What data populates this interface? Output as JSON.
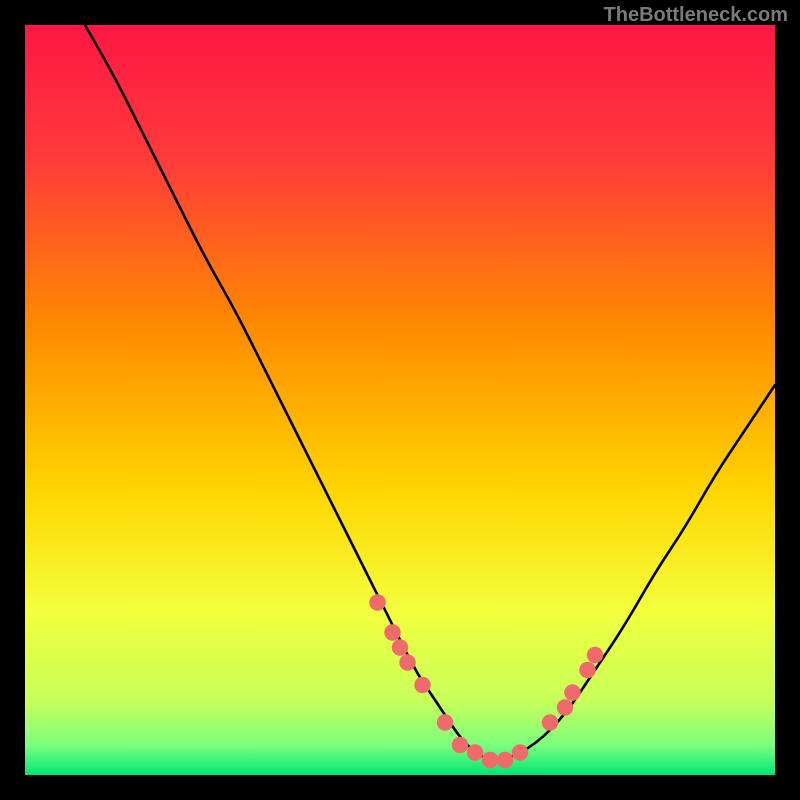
{
  "watermark": "TheBottleneck.com",
  "chart_data": {
    "type": "line",
    "title": "",
    "xlabel": "",
    "ylabel": "",
    "xlim": [
      0,
      100
    ],
    "ylim": [
      0,
      100
    ],
    "grid": false,
    "legend": false,
    "background_gradient_stops": [
      {
        "offset": 0.0,
        "color": "#ff1744"
      },
      {
        "offset": 0.18,
        "color": "#ff3b3b"
      },
      {
        "offset": 0.4,
        "color": "#ff8a00"
      },
      {
        "offset": 0.62,
        "color": "#ffd500"
      },
      {
        "offset": 0.78,
        "color": "#f4ff3d"
      },
      {
        "offset": 0.9,
        "color": "#c8ff5a"
      },
      {
        "offset": 0.96,
        "color": "#7dff7d"
      },
      {
        "offset": 1.0,
        "color": "#00e676"
      }
    ],
    "series": [
      {
        "name": "bottleneck-curve",
        "color": "#000000",
        "x": [
          8,
          12,
          16,
          20,
          24,
          28,
          32,
          36,
          40,
          44,
          48,
          52,
          54,
          56,
          58,
          60,
          62,
          64,
          68,
          72,
          76,
          80,
          84,
          88,
          92,
          96,
          100
        ],
        "y": [
          100,
          93,
          85,
          77,
          69,
          62,
          54,
          46,
          38,
          30,
          22,
          14,
          11,
          8,
          5,
          3,
          2,
          2,
          4,
          8,
          14,
          20,
          27,
          33,
          40,
          46,
          52
        ]
      }
    ],
    "markers": {
      "name": "highlight-dots",
      "color": "#ef6b6b",
      "radius": 1.1,
      "points": [
        {
          "x": 47,
          "y": 23
        },
        {
          "x": 49,
          "y": 19
        },
        {
          "x": 50,
          "y": 17
        },
        {
          "x": 51,
          "y": 15
        },
        {
          "x": 53,
          "y": 12
        },
        {
          "x": 56,
          "y": 7
        },
        {
          "x": 58,
          "y": 4
        },
        {
          "x": 60,
          "y": 3
        },
        {
          "x": 62,
          "y": 2
        },
        {
          "x": 64,
          "y": 2
        },
        {
          "x": 66,
          "y": 3
        },
        {
          "x": 70,
          "y": 7
        },
        {
          "x": 72,
          "y": 9
        },
        {
          "x": 73,
          "y": 11
        },
        {
          "x": 75,
          "y": 14
        },
        {
          "x": 76,
          "y": 16
        }
      ]
    }
  }
}
